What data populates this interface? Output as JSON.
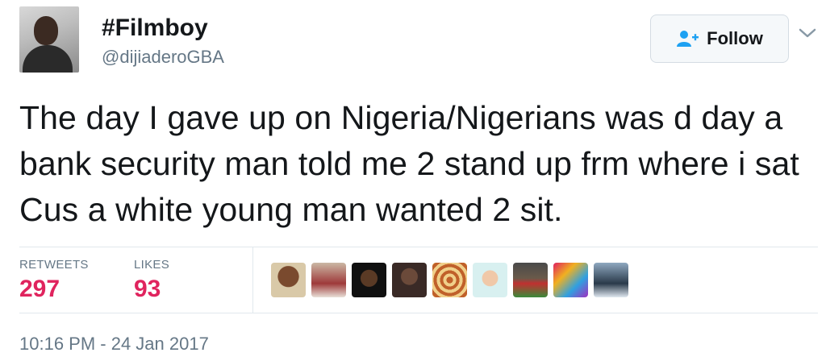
{
  "user": {
    "display_name": "#Filmboy",
    "handle": "@dijiaderoGBA"
  },
  "follow_button": {
    "label": "Follow",
    "icon": "add-user-icon"
  },
  "tweet": {
    "text": "The day I gave up on Nigeria/Nigerians was d day a bank security man told me 2 stand up frm where i sat Cus a white young man wanted 2 sit."
  },
  "stats": {
    "retweets": {
      "label": "RETWEETS",
      "value": "297"
    },
    "likes": {
      "label": "LIKES",
      "value": "93"
    }
  },
  "likers": [
    {
      "icon": "liker-avatar"
    },
    {
      "icon": "liker-avatar"
    },
    {
      "icon": "liker-avatar"
    },
    {
      "icon": "liker-avatar"
    },
    {
      "icon": "liker-avatar"
    },
    {
      "icon": "liker-avatar"
    },
    {
      "icon": "liker-avatar"
    },
    {
      "icon": "liker-avatar"
    },
    {
      "icon": "liker-avatar"
    }
  ],
  "timestamp": "10:16 PM - 24 Jan 2017",
  "colors": {
    "stat_value": "#e0245e",
    "secondary_text": "#657786",
    "follow_icon": "#1da1f2"
  }
}
